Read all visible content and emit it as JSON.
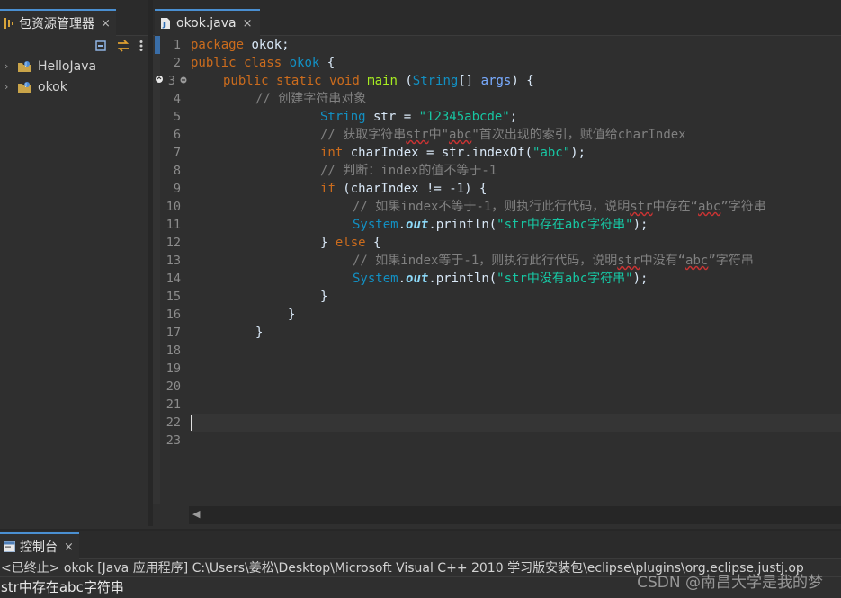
{
  "package_explorer": {
    "tab_label": "包资源管理器",
    "tab_close": "×",
    "toolbar_icons": [
      "collapse-all-icon",
      "link-with-editor-icon",
      "view-menu-icon"
    ],
    "projects": [
      {
        "name": "HelloJava",
        "chevron": "›"
      },
      {
        "name": "okok",
        "chevron": "›"
      }
    ]
  },
  "editor": {
    "tab_label": "okok.java",
    "tab_close": "×",
    "line_numbers": [
      "1",
      "2",
      "3",
      "4",
      "5",
      "6",
      "7",
      "8",
      "9",
      "10",
      "11",
      "12",
      "13",
      "14",
      "15",
      "16",
      "17",
      "18",
      "19",
      "20",
      "21",
      "22",
      "23"
    ],
    "current_line": 22,
    "colors": {
      "keyword": "#cc6c1d",
      "type": "#1290c3",
      "string": "#17c6a3",
      "comment": "#808080",
      "background": "#2f2f2f"
    },
    "code": {
      "l1_kw": "package",
      "l1_rest": " okok;",
      "l2_kw1": "public",
      "l2_kw2": "class",
      "l2_name": "okok",
      "l2_rest": " {",
      "l3_kw1": "public",
      "l3_kw2": "static",
      "l3_kw3": "void",
      "l3_fn": "main",
      "l3_p1": " (",
      "l3_ty": "String",
      "l3_p2": "[] ",
      "l3_var": "args",
      "l3_p3": ") {",
      "l4_cm": "// 创建字符串对象",
      "l5_ty": "String",
      "l5_mid": " str = ",
      "l5_str": "\"12345abcde\"",
      "l5_end": ";",
      "l6_cm_a": "// 获取字符串",
      "l6_cm_str": "str",
      "l6_cm_b": "中\"",
      "l6_cm_abc": "abc",
      "l6_cm_c": "\"首次出现的索引，赋值给charIndex",
      "l7_kw": "int",
      "l7_mid": " charIndex = str.indexOf(",
      "l7_str": "\"abc\"",
      "l7_end": ");",
      "l8_cm": "// 判断：index的值不等于-1",
      "l9_kw": "if",
      "l9_rest": " (charIndex != -1) {",
      "l10_cm_a": "// 如果index不等于-1，则执行此行代码，说明",
      "l10_cm_str": "str",
      "l10_cm_b": "中存在“",
      "l10_cm_abc": "abc",
      "l10_cm_c": "”字符串",
      "l11_ty": "System",
      "l11_dot": ".",
      "l11_fld": "out",
      "l11_mid": ".println(",
      "l11_str": "\"str中存在abc字符串\"",
      "l11_end": ");",
      "l12_a": "} ",
      "l12_kw": "else",
      "l12_b": " {",
      "l13_cm_a": "// 如果index等于-1，则执行此行代码，说明",
      "l13_cm_str": "str",
      "l13_cm_b": "中没有“",
      "l13_cm_abc": "abc",
      "l13_cm_c": "”字符串",
      "l14_ty": "System",
      "l14_dot": ".",
      "l14_fld": "out",
      "l14_mid": ".println(",
      "l14_str": "\"str中没有abc字符串\"",
      "l14_end": ");",
      "l15": "}",
      "l16": "}",
      "l17": "}"
    },
    "scroll_left_arrow": "◀"
  },
  "console": {
    "tab_label": "控制台",
    "tab_close": "×",
    "status": "<已终止> okok [Java 应用程序] C:\\Users\\姜松\\Desktop\\Microsoft Visual C++ 2010 学习版安装包\\eclipse\\plugins\\org.eclipse.justj.op",
    "output": "str中存在abc字符串"
  },
  "watermark": "CSDN @南昌大学是我的梦"
}
